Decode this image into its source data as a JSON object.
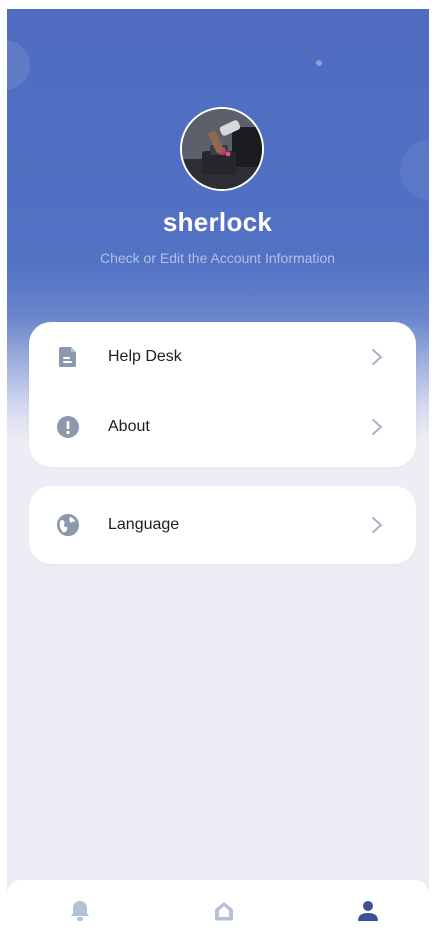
{
  "profile": {
    "username": "sherlock",
    "subtitle": "Check or Edit the Account Information"
  },
  "menu_group_1": [
    {
      "label": "Help Desk",
      "icon": "document-icon"
    },
    {
      "label": "About",
      "icon": "info-icon"
    }
  ],
  "menu_group_2": [
    {
      "label": "Language",
      "icon": "globe-icon"
    }
  ],
  "tabbar": {
    "items": [
      {
        "icon": "bell-icon",
        "active": false
      },
      {
        "icon": "home-icon",
        "active": false
      },
      {
        "icon": "user-icon",
        "active": true
      }
    ]
  },
  "colors": {
    "header_blue": "#4f6cc0",
    "icon_gray": "#8c99ad",
    "icon_light": "#b4c0d6",
    "active_tab": "#3d4f9a",
    "page_bg": "#eeedf5"
  }
}
